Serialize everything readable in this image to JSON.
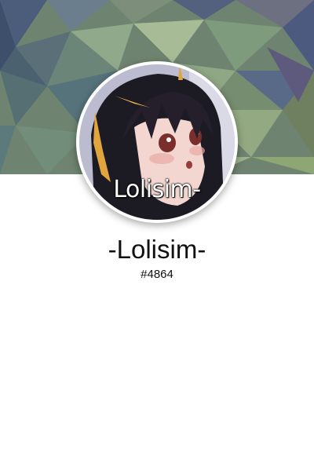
{
  "profile": {
    "avatar_caption": "Lolisim-",
    "username": "-Lolisim-",
    "discriminator": "#4864"
  },
  "icons": {
    "banner": "low-poly-banner-image",
    "avatar": "avatar-image"
  },
  "colors": {
    "background": "#ffffff",
    "text": "#111111",
    "banner_palette": [
      "#3e5270",
      "#6f8a6d",
      "#9db08f",
      "#4d5d82",
      "#8a9f85",
      "#5b6f5e"
    ]
  }
}
